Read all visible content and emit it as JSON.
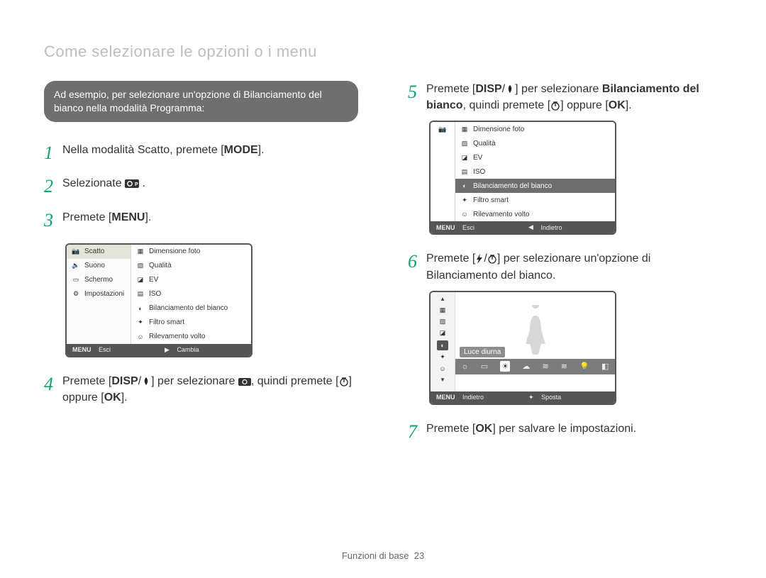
{
  "page_title": "Come selezionare le opzioni o i menu",
  "callout": "Ad esempio, per selezionare un'opzione di Bilanciamento del bianco nella modalità Programma:",
  "buttons": {
    "mode": "MODE",
    "menu": "MENU",
    "disp": "DISP",
    "ok": "OK"
  },
  "steps": {
    "s1_a": "Nella modalità Scatto, premete [",
    "s1_b": "].",
    "s2_a": "Selezionate ",
    "s2_b": ".",
    "s3_a": "Premete [",
    "s3_b": "].",
    "s4_a": "Premete [",
    "s4_b": "] per selezionare ",
    "s4_c": ", quindi premete [",
    "s4_d": "] oppure [",
    "s4_e": "].",
    "s5_a": "Premete [",
    "s5_b": "] per selezionare ",
    "s5_bold": "Bilanciamento del bianco",
    "s5_c": ", quindi premete [",
    "s5_d": "] oppure [",
    "s5_e": "].",
    "s6_a": "Premete [",
    "s6_b": "] per selezionare un'opzione di Bilanciamento del bianco.",
    "s7_a": "Premete [",
    "s7_b": "] per salvare le impostazioni."
  },
  "lcd1": {
    "left": [
      "Scatto",
      "Suono",
      "Schermo",
      "Impostazioni"
    ],
    "right": [
      "Dimensione foto",
      "Qualità",
      "EV",
      "ISO",
      "Bilanciamento del bianco",
      "Filtro smart",
      "Rilevamento volto"
    ],
    "foot_left_label": "MENU",
    "foot_left": "Esci",
    "foot_right": "Cambia"
  },
  "lcd2": {
    "right": [
      "Dimensione foto",
      "Qualità",
      "EV",
      "ISO",
      "Bilanciamento del bianco",
      "Filtro smart",
      "Rilevamento volto"
    ],
    "selected_index": 4,
    "foot_left_label": "MENU",
    "foot_left": "Esci",
    "foot_right": "Indietro"
  },
  "lcd3": {
    "wb_label": "Luce diurna",
    "foot_left_label": "MENU",
    "foot_left": "Indietro",
    "foot_right": "Sposta"
  },
  "footer": {
    "section": "Funzioni di base",
    "page": "23"
  }
}
